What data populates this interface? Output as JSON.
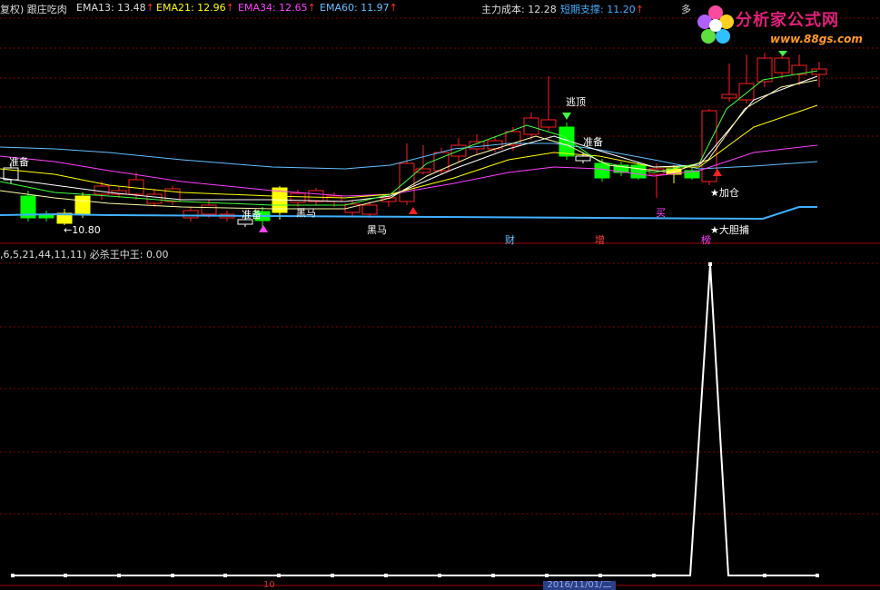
{
  "header": {
    "indicator": "复权) 跟庄吃肉",
    "ema13": "EMA13: 13.48",
    "ema21": "EMA21: 12.96",
    "ema34": "EMA34: 12.65",
    "ema60": "EMA60: 11.97",
    "main_cost": "主力成本: 12.28",
    "short_support": "短期支撑: 11.20",
    "duo": "多"
  },
  "logo": {
    "title": "分析家公式网",
    "url": "www.88gs.com"
  },
  "colors": {
    "ema13": "#ffffff",
    "ema21": "#ffff00",
    "ema34": "#ff40ff",
    "ema60": "#60c0ff",
    "up": "#ff2020",
    "down": "#00ff00",
    "support": "#40b0ff",
    "grid": "#800000"
  },
  "signals": {
    "zhunbei_left": "准备",
    "price_low": "←10.80",
    "zhunbei_mid": "准备",
    "heima_1": "黑马",
    "heima_2": "黑马",
    "taoding": "逃顶",
    "zhunbei_right": "准备",
    "jiacang": "★加仓",
    "mai": "买",
    "cai": "财",
    "zeng": "增",
    "bang": "榜",
    "dadanbu": "★大胆捕"
  },
  "lower_panel": {
    "title": ",6,5,21,44,11,11) 必杀王中王: 0.00"
  },
  "axis": {
    "tick_label": "10",
    "date_label": "2016/11/01/二"
  }
}
